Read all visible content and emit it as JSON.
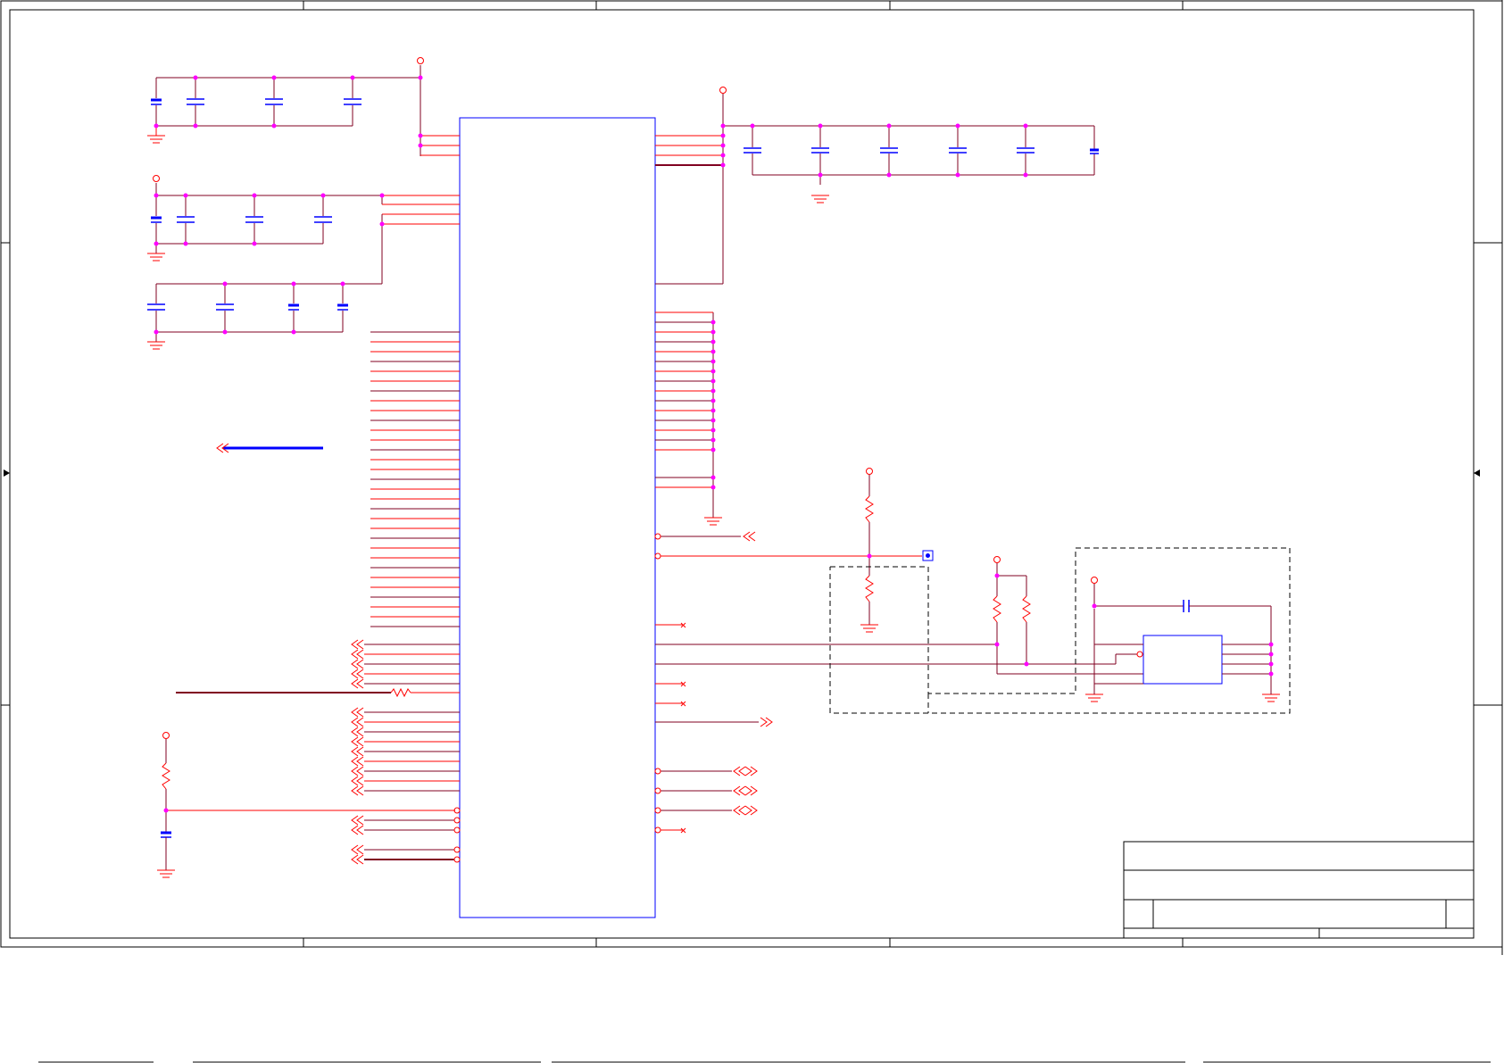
{
  "sheet": {
    "title_block_fields": {
      "title": "",
      "size": "",
      "document_number": "",
      "revision": "",
      "date": "",
      "sheet": ""
    }
  },
  "colors": {
    "wire": "#ff0000",
    "bus": "#800020",
    "component": "#0000ff",
    "junction": "#ff00ff",
    "frame": "#000000",
    "dashed_group": "#000000"
  },
  "icons": {
    "power_port": "open-circle-terminal-icon",
    "ground": "ground-symbol-icon",
    "offpage_connector": "double-chevron-icon",
    "no_connect": "x-mark-icon",
    "test_point": "square-pad-icon"
  }
}
